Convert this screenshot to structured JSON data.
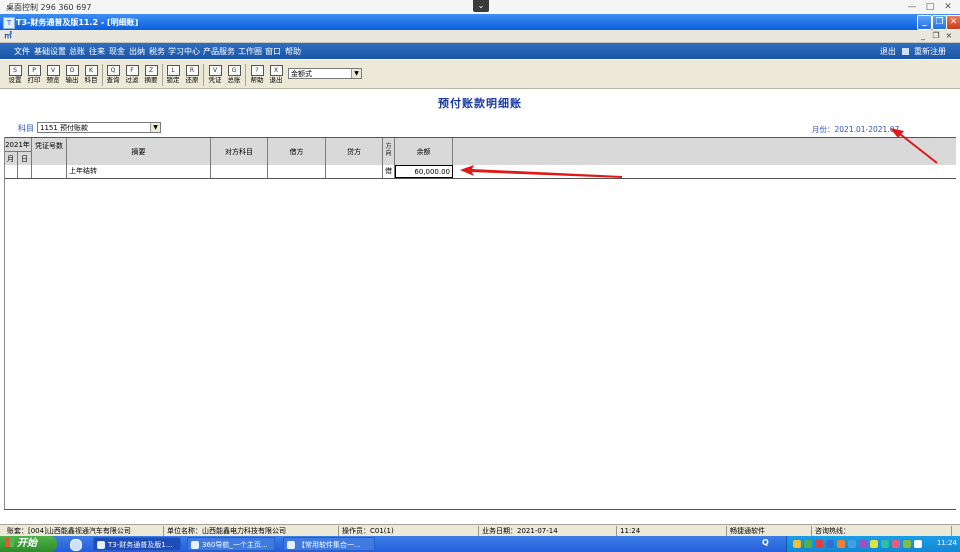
{
  "remote": {
    "title": "桌面控制 296 360 697",
    "tab_icon": "⌄",
    "minimize": "—",
    "maximize": "□",
    "close": "✕"
  },
  "window": {
    "title": "T3-财务通普及版11.2 - [明细账]",
    "min": "_",
    "max": "❐",
    "close": "✕"
  },
  "mdi": {
    "logo": "㎡",
    "min": "_",
    "restore": "❐",
    "close": "×"
  },
  "menu": {
    "items": [
      "文件",
      "基础设置",
      "总账",
      "往来",
      "现金",
      "出纳",
      "税务",
      "学习中心",
      "产品服务",
      "工作圈",
      "窗口",
      "帮助"
    ],
    "right": [
      "退出",
      "重新注册"
    ]
  },
  "toolbar": {
    "buttons": [
      {
        "label": "设置",
        "icon": "S"
      },
      {
        "label": "打印",
        "icon": "P"
      },
      {
        "label": "预览",
        "icon": "V"
      },
      {
        "label": "输出",
        "icon": "O"
      },
      {
        "label": "科目",
        "icon": "K"
      },
      {
        "label": "查询",
        "icon": "Q"
      },
      {
        "label": "过滤",
        "icon": "F"
      },
      {
        "label": "摘要",
        "icon": "Z"
      },
      {
        "label": "锁定",
        "icon": "L"
      },
      {
        "label": "还原",
        "icon": "R"
      },
      {
        "label": "凭证",
        "icon": "V"
      },
      {
        "label": "总账",
        "icon": "G"
      },
      {
        "label": "帮助",
        "icon": "?"
      },
      {
        "label": "退出",
        "icon": "X"
      }
    ],
    "format_value": "金额式"
  },
  "report": {
    "title": "预付账款明细账",
    "subject_label": "科目",
    "subject_value": "1151 预付账款",
    "month_range": "月份：2021.01-2021.07"
  },
  "grid": {
    "year": "2021年",
    "month": "月",
    "day": "日",
    "columns": [
      "凭证号数",
      "摘要",
      "对方科目",
      "借方",
      "贷方",
      "方向",
      "余额"
    ],
    "rows": [
      {
        "month": "",
        "day": "",
        "voucher": "",
        "summary": "上年结转",
        "counter": "",
        "debit": "",
        "credit": "",
        "direction": "借",
        "balance": "60,000.00"
      }
    ]
  },
  "status": {
    "account": "账套：[004]山西能鑫视通汽车有限公司",
    "unit": "单位名称：山西能鑫电力科技有限公司",
    "operator": "操作员：C01(1)",
    "date": "业务日期：2021-07-14",
    "time": "11:24",
    "vendor": "畅捷通软件",
    "hotline": "咨询热线："
  },
  "taskbar": {
    "start": "开始",
    "tasks": [
      "T3-财务通普及版1...",
      "360导航_一个主页...",
      "【常用软件集合一..."
    ],
    "q": "Q",
    "clock": "11:24"
  },
  "colors": {
    "title_blue": "#0a5fdc",
    "menu_blue": "#1b55a8",
    "accent_red": "#e01818"
  }
}
